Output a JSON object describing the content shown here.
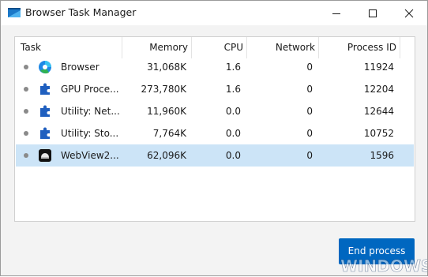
{
  "window": {
    "title": "Browser Task Manager"
  },
  "colors": {
    "accent": "#0067c0",
    "selected_row": "#cce4f7",
    "edge_blue": "#1e88e5",
    "puzzle_blue": "#1f5fbf"
  },
  "columns": {
    "task": "Task",
    "memory": "Memory",
    "cpu": "CPU",
    "network": "Network",
    "process_id": "Process ID"
  },
  "rows": [
    {
      "icon": "edge-browser-icon",
      "task": "Browser",
      "memory": "31,068K",
      "cpu": "1.6",
      "network": "0",
      "process_id": "11924",
      "selected": false
    },
    {
      "icon": "puzzle-piece-icon",
      "task": "GPU Proce...",
      "memory": "273,780K",
      "cpu": "1.6",
      "network": "0",
      "process_id": "12204",
      "selected": false
    },
    {
      "icon": "puzzle-piece-icon",
      "task": "Utility: Net...",
      "memory": "11,960K",
      "cpu": "0.0",
      "network": "0",
      "process_id": "12644",
      "selected": false
    },
    {
      "icon": "puzzle-piece-icon",
      "task": "Utility: Sto...",
      "memory": "7,764K",
      "cpu": "0.0",
      "network": "0",
      "process_id": "10752",
      "selected": false
    },
    {
      "icon": "webview-app-icon",
      "task": "WebView2...",
      "memory": "62,096K",
      "cpu": "0.0",
      "network": "0",
      "process_id": "1596",
      "selected": true
    }
  ],
  "end_process_label": "End process",
  "watermark": "WINDOWS XL"
}
